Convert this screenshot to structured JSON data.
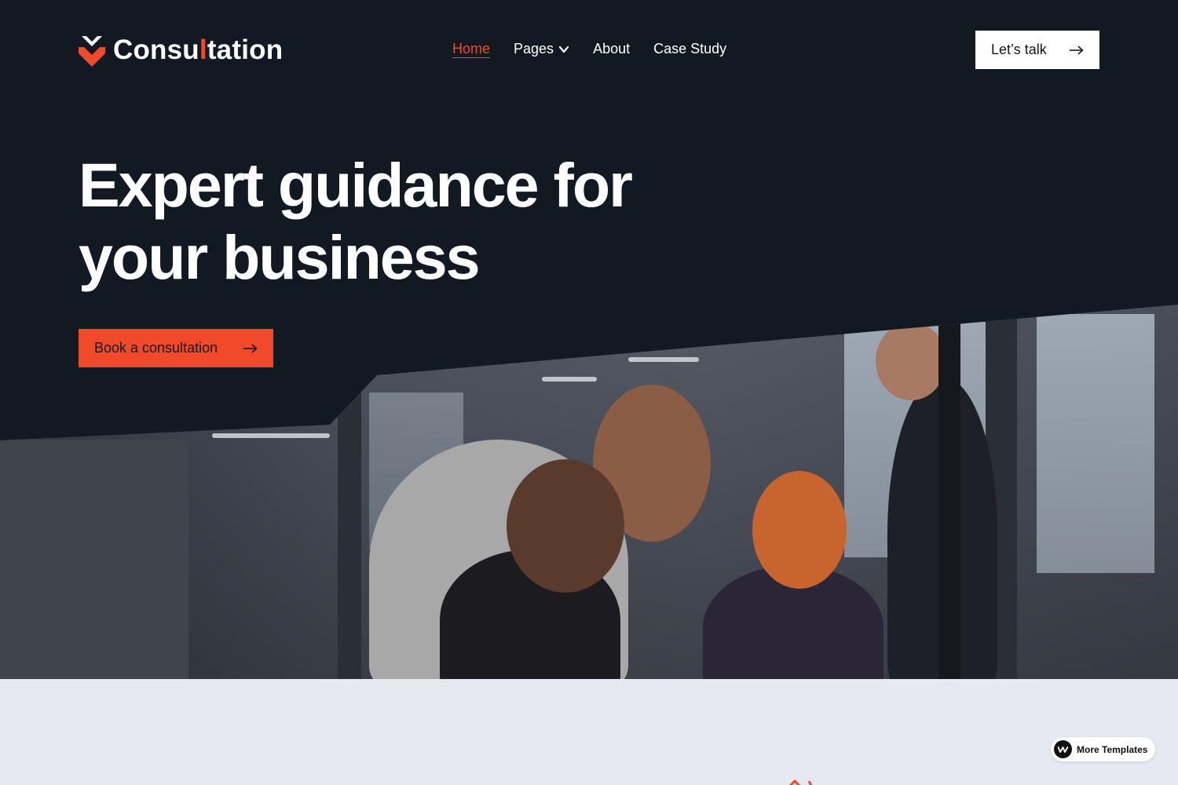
{
  "brand": {
    "name_before": "Consu",
    "name_accent": "l",
    "name_after": "tation",
    "accent_color": "#f04a2a"
  },
  "nav": {
    "items": [
      {
        "label": "Home",
        "active": true
      },
      {
        "label": "Pages",
        "has_dropdown": true
      },
      {
        "label": "About"
      },
      {
        "label": "Case Study"
      }
    ]
  },
  "header_cta": {
    "label": "Let’s talk",
    "icon": "arrow-right-icon"
  },
  "hero": {
    "headline_line1": "Expert guidance for",
    "headline_line2": "your business",
    "cta_label": "Book a consultation",
    "cta_icon": "arrow-right-icon",
    "background_color": "#131922",
    "image": "office-team-photo"
  },
  "badge": {
    "label": "More Templates",
    "icon": "webflow-icon"
  },
  "colors": {
    "dark": "#131922",
    "accent": "#f04a2a",
    "light_bg": "#e6eaf0"
  }
}
